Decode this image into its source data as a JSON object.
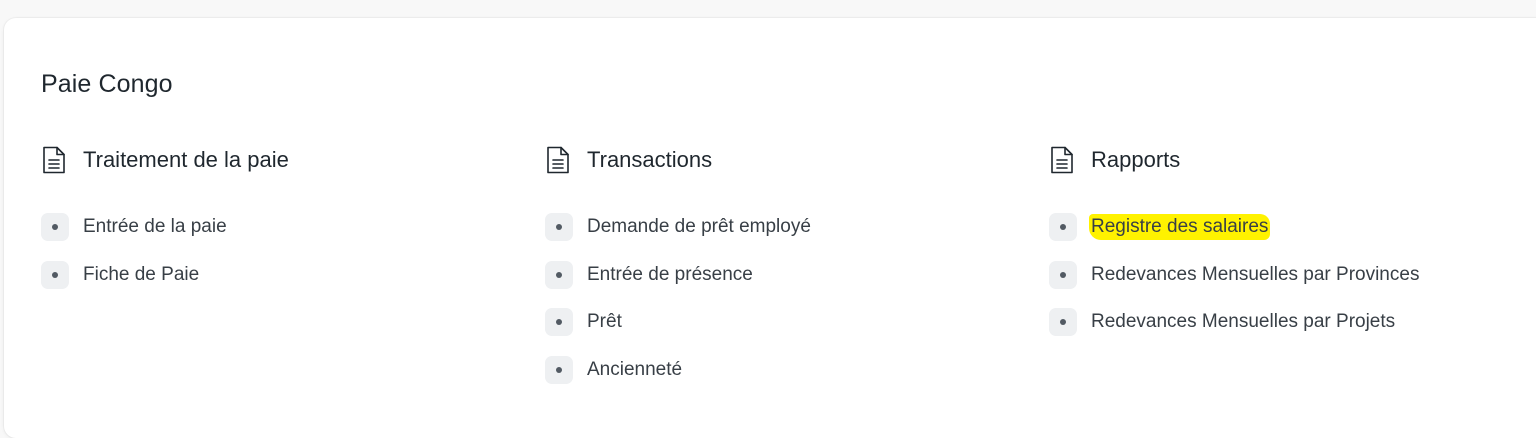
{
  "workspace": {
    "title": "Paie Congo"
  },
  "columns": [
    {
      "title": "Traitement de la paie",
      "icon": "document-icon",
      "links": [
        "Entrée de la paie",
        "Fiche de Paie"
      ]
    },
    {
      "title": "Transactions",
      "icon": "document-icon",
      "links": [
        "Demande de prêt employé",
        "Entrée de présence",
        "Prêt",
        "Ancienneté"
      ]
    },
    {
      "title": "Rapports",
      "icon": "document-icon",
      "links": [
        "Registre des salaires",
        "Redevances Mensuelles par Provinces",
        "Redevances Mensuelles par Projets"
      ]
    }
  ],
  "highlighted_link": "Registre des salaires",
  "colors": {
    "highlight": "#fff200",
    "bullet_bg": "#eef0f2",
    "text": "#1f272e"
  }
}
